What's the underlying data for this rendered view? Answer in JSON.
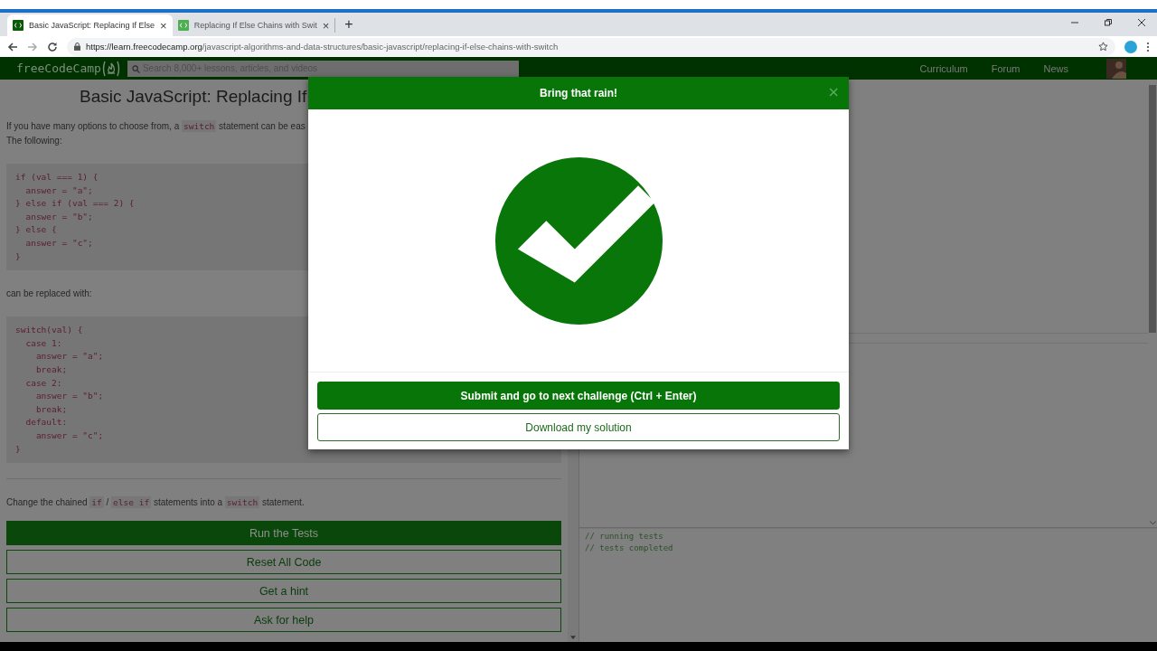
{
  "browser": {
    "tabs": [
      {
        "title": "Basic JavaScript: Replacing If Else",
        "close": "×",
        "selected": true
      },
      {
        "title": "Replacing If Else Chains with Swit",
        "close": "×",
        "selected": false
      }
    ],
    "new_tab": "+",
    "address": {
      "host": "https://learn.freecodecamp.org",
      "path": "/javascript-algorithms-and-data-structures/basic-javascript/replacing-if-else-chains-with-switch"
    }
  },
  "nav": {
    "logo": "freeCodeCamp",
    "search": {
      "placeholder": "Search 8,000+ lessons, articles, and videos"
    },
    "links": [
      "Curriculum",
      "Forum",
      "News"
    ]
  },
  "lesson": {
    "title": "Basic JavaScript: Replacing If",
    "intro": [
      [
        {
          "text": "If you have many options to choose from, a ",
          "kind": "text"
        },
        {
          "text": "switch",
          "kind": "code"
        },
        {
          "text": " statement can be eas",
          "kind": "text"
        }
      ],
      [
        {
          "text": "The following:",
          "kind": "text"
        }
      ]
    ],
    "code_1": [
      "if (val === 1) {",
      "  answer = \"a\";",
      "} else if (val === 2) {",
      "  answer = \"b\";",
      "} else {",
      "  answer = \"c\";",
      "}"
    ],
    "middle": "can be replaced with:",
    "code_2": [
      "switch(val) {",
      "  case 1:",
      "    answer = \"a\";",
      "    break;",
      "  case 2:",
      "    answer = \"b\";",
      "    break;",
      "  default:",
      "    answer = \"c\";",
      "}"
    ],
    "task": [
      {
        "text": "Change the chained ",
        "kind": "text"
      },
      {
        "text": "if",
        "kind": "code"
      },
      {
        "text": " / ",
        "kind": "text"
      },
      {
        "text": "else if",
        "kind": "code"
      },
      {
        "text": " statements into a ",
        "kind": "text"
      },
      {
        "text": "switch",
        "kind": "code"
      },
      {
        "text": " statement.",
        "kind": "text"
      }
    ],
    "buttons": [
      {
        "label": "Run the Tests",
        "kind": "primary"
      },
      {
        "label": "Reset All Code",
        "kind": "outline"
      },
      {
        "label": "Get a hint",
        "kind": "outline"
      },
      {
        "label": "Ask for help",
        "kind": "outline"
      }
    ]
  },
  "console": [
    "// running tests",
    "// tests completed"
  ],
  "modal": {
    "title": "Bring that rain!",
    "close": "×",
    "buttons": [
      {
        "label": "Submit and go to next challenge (Ctrl + Enter)",
        "kind": "primary"
      },
      {
        "label": "Download my solution",
        "kind": "outline"
      }
    ]
  }
}
